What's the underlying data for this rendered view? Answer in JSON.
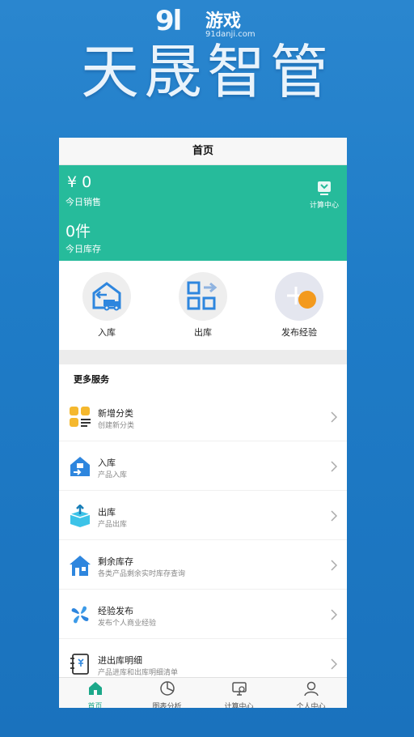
{
  "watermark": {
    "logo": "9l",
    "name": "游戏",
    "url": "91danji.com"
  },
  "hero": {
    "title": "天晟智管"
  },
  "app": {
    "nav_title": "首页",
    "stats": {
      "sales_amount": "¥ 0",
      "sales_label": "今日销售",
      "stock_count": "0件",
      "stock_label": "今日库存",
      "calc_label": "计算中心"
    },
    "quick_actions": [
      {
        "label": "入库",
        "icon": "warehouse-truck-icon"
      },
      {
        "label": "出库",
        "icon": "grid-arrow-icon"
      },
      {
        "label": "发布经验",
        "icon": "add-publish-icon"
      }
    ],
    "services": {
      "title": "更多服务",
      "items": [
        {
          "title": "新增分类",
          "subtitle": "创建新分类",
          "icon": "category-icon"
        },
        {
          "title": "入库",
          "subtitle": "产品入库",
          "icon": "house-in-icon"
        },
        {
          "title": "出库",
          "subtitle": "产品出库",
          "icon": "box-out-icon"
        },
        {
          "title": "剩余库存",
          "subtitle": "各类产品剩余实时库存查询",
          "icon": "home-stock-icon"
        },
        {
          "title": "经验发布",
          "subtitle": "发布个人商业经验",
          "icon": "pinwheel-icon"
        },
        {
          "title": "进出库明细",
          "subtitle": "产品进库和出库明细清单",
          "icon": "ledger-icon"
        }
      ]
    },
    "tabs": [
      {
        "label": "首页",
        "icon": "home-icon",
        "active": true
      },
      {
        "label": "图表分析",
        "icon": "pie-chart-icon",
        "active": false
      },
      {
        "label": "计算中心",
        "icon": "monitor-icon",
        "active": false
      },
      {
        "label": "个人中心",
        "icon": "user-icon",
        "active": false
      }
    ]
  },
  "colors": {
    "background": "#1f7cc7",
    "accent": "#26bb9b",
    "icon_blue": "#2e86de",
    "active_tab": "#1ca88a"
  }
}
